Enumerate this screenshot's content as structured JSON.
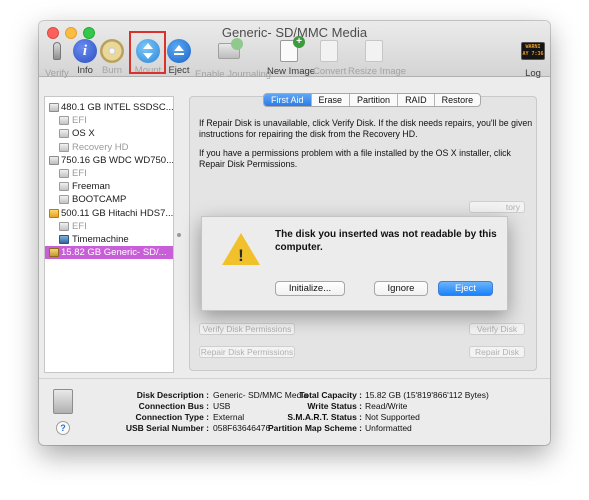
{
  "window": {
    "title": "Generic- SD/MMC Media"
  },
  "toolbar": {
    "items": [
      {
        "label": "Verify",
        "icon": "microscope-icon",
        "enabled": false
      },
      {
        "label": "Info",
        "icon": "info-icon",
        "enabled": true
      },
      {
        "label": "Burn",
        "icon": "burn-disc-icon",
        "enabled": false
      },
      {
        "label": "Mount",
        "icon": "mount-icon",
        "enabled": false
      },
      {
        "label": "Eject",
        "icon": "eject-icon",
        "enabled": true
      },
      {
        "label": "Enable Journaling",
        "icon": "journaling-icon",
        "enabled": false
      },
      {
        "label": "New Image",
        "icon": "new-image-icon",
        "enabled": true
      },
      {
        "label": "Convert",
        "icon": "convert-icon",
        "enabled": false
      },
      {
        "label": "Resize Image",
        "icon": "resize-image-icon",
        "enabled": false
      },
      {
        "label": "Log",
        "icon": "log-icon",
        "enabled": true
      }
    ],
    "log_icon_text": "WARNI\nAY 7:36"
  },
  "sidebar": {
    "items": [
      {
        "label": "480.1 GB INTEL SSDSC...",
        "kind": "disk",
        "indent": 0,
        "dim": false,
        "selected": false
      },
      {
        "label": "EFI",
        "kind": "volume",
        "indent": 1,
        "dim": true,
        "selected": false
      },
      {
        "label": "OS X",
        "kind": "volume",
        "indent": 1,
        "dim": false,
        "selected": false
      },
      {
        "label": "Recovery HD",
        "kind": "volume",
        "indent": 1,
        "dim": true,
        "selected": false
      },
      {
        "label": "750.16 GB WDC WD750...",
        "kind": "disk",
        "indent": 0,
        "dim": false,
        "selected": false
      },
      {
        "label": "EFI",
        "kind": "volume",
        "indent": 1,
        "dim": true,
        "selected": false
      },
      {
        "label": "Freeman",
        "kind": "volume",
        "indent": 1,
        "dim": false,
        "selected": false
      },
      {
        "label": "BOOTCAMP",
        "kind": "volume",
        "indent": 1,
        "dim": false,
        "selected": false
      },
      {
        "label": "500.11 GB Hitachi HDS7...",
        "kind": "external",
        "indent": 0,
        "dim": false,
        "selected": false
      },
      {
        "label": "EFI",
        "kind": "volume",
        "indent": 1,
        "dim": true,
        "selected": false
      },
      {
        "label": "Timemachine",
        "kind": "timemachine",
        "indent": 1,
        "dim": false,
        "selected": false
      },
      {
        "label": "15.82 GB Generic- SD/...",
        "kind": "sdcard",
        "indent": 0,
        "dim": false,
        "selected": true
      }
    ]
  },
  "tabs": [
    {
      "label": "First Aid",
      "active": true
    },
    {
      "label": "Erase",
      "active": false
    },
    {
      "label": "Partition",
      "active": false
    },
    {
      "label": "RAID",
      "active": false
    },
    {
      "label": "Restore",
      "active": false
    }
  ],
  "first_aid": {
    "para1": "If Repair Disk is unavailable, click Verify Disk. If the disk needs repairs, you'll be given instructions for repairing the disk from the Recovery HD.",
    "para2": "If you have a permissions problem with a file installed by the OS X installer, click Repair Disk Permissions.",
    "show_details_partial": "tory",
    "verify_permissions": "Verify Disk Permissions",
    "repair_permissions": "Repair Disk Permissions",
    "verify_disk": "Verify Disk",
    "repair_disk": "Repair Disk"
  },
  "alert": {
    "message": "The disk you inserted was not readable by this computer.",
    "initialize": "Initialize...",
    "ignore": "Ignore",
    "eject": "Eject"
  },
  "info": {
    "left": [
      {
        "label": "Disk Description :",
        "value": "Generic- SD/MMC Media"
      },
      {
        "label": "Connection Bus :",
        "value": "USB"
      },
      {
        "label": "Connection Type :",
        "value": "External"
      },
      {
        "label": "USB Serial Number :",
        "value": "058F63646476"
      }
    ],
    "right": [
      {
        "label": "Total Capacity :",
        "value": "15.82 GB (15'819'866'112 Bytes)"
      },
      {
        "label": "Write Status :",
        "value": "Read/Write"
      },
      {
        "label": "S.M.A.R.T. Status :",
        "value": "Not Supported"
      },
      {
        "label": "Partition Map Scheme :",
        "value": "Unformatted"
      }
    ],
    "help": "?"
  }
}
